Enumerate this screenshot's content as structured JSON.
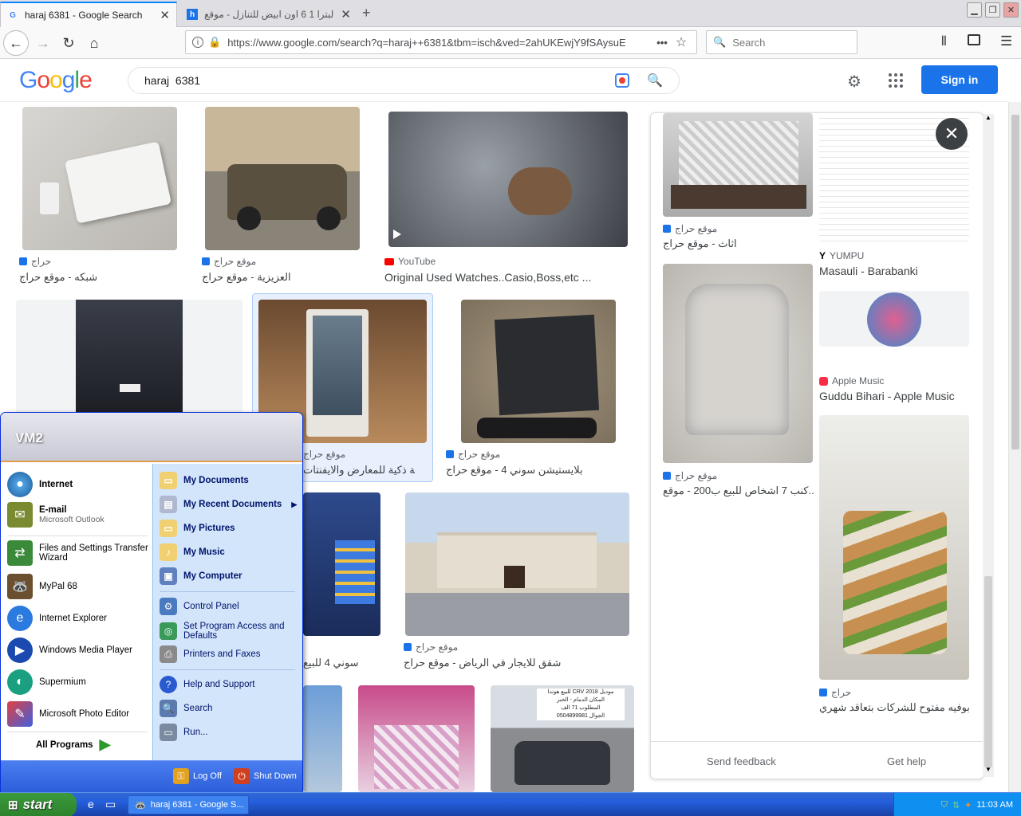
{
  "browser": {
    "tabs": [
      {
        "title": "haraj 6381 - Google Search",
        "active": true
      },
      {
        "title": "البترا 1 6 اون ابيض للتنازل - موقع <",
        "active": false
      }
    ],
    "url": "https://www.google.com/search?q=haraj++6381&tbm=isch&ved=2ahUKEwjY9fSAysuE",
    "search_placeholder": "Search"
  },
  "google": {
    "query": "haraj  6381",
    "sign_in": "Sign in"
  },
  "results": [
    {
      "source": "حراج",
      "caption": "شبكه - موقع حراج"
    },
    {
      "source": "موقع حراج",
      "caption": "العزيزية - موقع حراج"
    },
    {
      "source": "YouTube",
      "caption": "Original Used Watches..Casio,Boss,etc ..."
    },
    {
      "source": "موقع حراج",
      "caption": "شاشة ذكية للمعارض والايفنتات"
    },
    {
      "source": "موقع حراج",
      "caption": "بلايستيشن سوني 4 - موقع حراج"
    },
    {
      "caption": "سوني 4 للبيع"
    },
    {
      "source": "موقع حراج",
      "caption": "شقق للايجار في الرياض - موقع حراج"
    }
  ],
  "panel": {
    "items": [
      {
        "source": "موقع حراج",
        "caption": "اثاث - موقع حراج"
      },
      {
        "source": "YUMPU",
        "caption": "Masauli - Barabanki"
      },
      {
        "source": "Apple Music",
        "caption": "Guddu Bihari - Apple Music"
      },
      {
        "source": "موقع حراج",
        "caption": "كنب 7 اشخاص للبيع ب200 - موقع..."
      },
      {
        "source": "حراج",
        "caption": "بوفيه مفتوح للشركات بتعاقد شهري - ..."
      }
    ],
    "send_feedback": "Send feedback",
    "get_help": "Get help",
    "car_sign": {
      "line1": "للبيع هوندا CRV موديل 2018",
      "line2": "المكان الدمام - الخبر",
      "line3": "المطلوب 71 الف",
      "line4": "الجوال 0504899981"
    }
  },
  "start_menu": {
    "user": "VM2",
    "left_items": [
      {
        "label": "Internet"
      },
      {
        "label": "E-mail",
        "sub": "Microsoft Outlook"
      },
      {
        "label": "Files and Settings Transfer Wizard"
      },
      {
        "label": "MyPal 68"
      },
      {
        "label": "Internet Explorer"
      },
      {
        "label": "Windows Media Player"
      },
      {
        "label": "Supermium"
      },
      {
        "label": "Microsoft Photo Editor"
      }
    ],
    "all_programs": "All Programs",
    "right_items": [
      {
        "label": "My Documents"
      },
      {
        "label": "My Recent Documents"
      },
      {
        "label": "My Pictures"
      },
      {
        "label": "My Music"
      },
      {
        "label": "My Computer"
      },
      {
        "label": "Control Panel"
      },
      {
        "label": "Set Program Access and Defaults"
      },
      {
        "label": "Printers and Faxes"
      },
      {
        "label": "Help and Support"
      },
      {
        "label": "Search"
      },
      {
        "label": "Run..."
      }
    ],
    "log_off": "Log Off",
    "shut_down": "Shut Down"
  },
  "taskbar": {
    "start": "start",
    "task": "haraj 6381 - Google S...",
    "clock": "11:03 AM"
  }
}
